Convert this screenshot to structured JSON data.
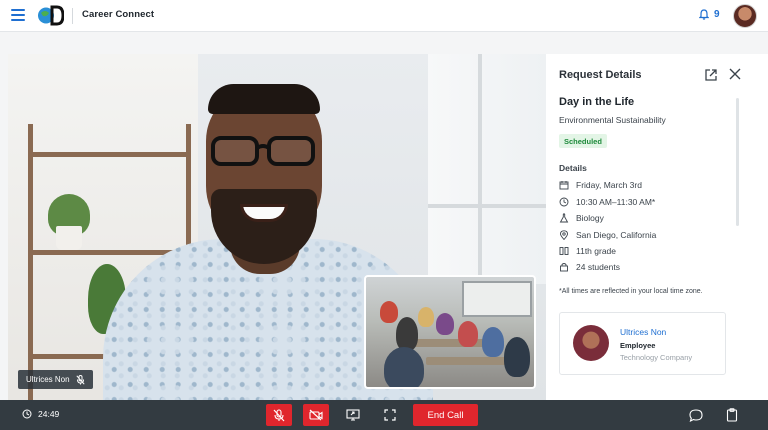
{
  "header": {
    "app_title": "Career Connect",
    "notification_count": "9"
  },
  "video": {
    "participant_name": "Ultrices Non"
  },
  "panel": {
    "title": "Request Details",
    "event_title": "Day in the Life",
    "event_subtitle": "Environmental Sustainability",
    "status": "Scheduled",
    "details_heading": "Details",
    "details": {
      "date": "Friday, March 3rd",
      "time": "10:30 AM–11:30 AM*",
      "subject": "Biology",
      "location": "San Diego, California",
      "grade": "11th grade",
      "students": "24 students"
    },
    "timezone_note": "*All times are reflected in your local time zone.",
    "contact": {
      "name": "Ultrices Non",
      "role": "Employee",
      "company": "Technology Company"
    }
  },
  "controls": {
    "timer": "24:49",
    "end_call_label": "End Call"
  },
  "colors": {
    "accent": "#1f6fd1",
    "danger": "#e0262d",
    "bar": "#333b41",
    "scheduled_bg": "#e3f5e6",
    "scheduled_text": "#1d8a3a"
  }
}
